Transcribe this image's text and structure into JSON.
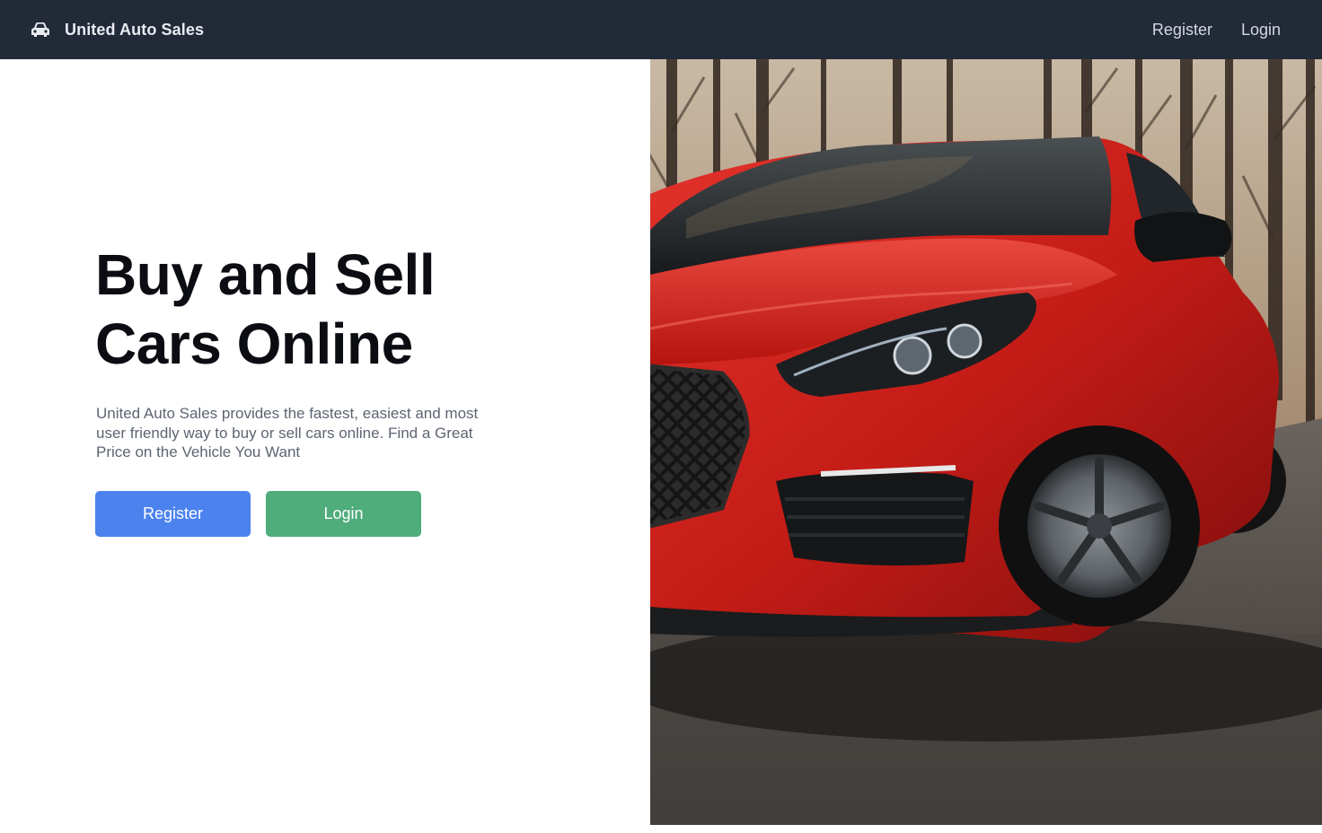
{
  "navbar": {
    "brand_name": "United Auto Sales",
    "brand_icon": "car-icon",
    "links": {
      "register": "Register",
      "login": "Login"
    }
  },
  "hero": {
    "title_line1": "Buy and Sell",
    "title_line2": "Cars Online",
    "description": "United Auto Sales provides the fastest, easiest and most user friendly way to buy or sell cars online. Find a Great Price on the Vehicle You Want",
    "register_button": "Register",
    "login_button": "Login",
    "image": "red-car-photo"
  },
  "colors": {
    "navbar_bg": "#222a38",
    "register_button": "#4b82ee",
    "login_button": "#4fac7b",
    "car_body": "#d3211c"
  }
}
